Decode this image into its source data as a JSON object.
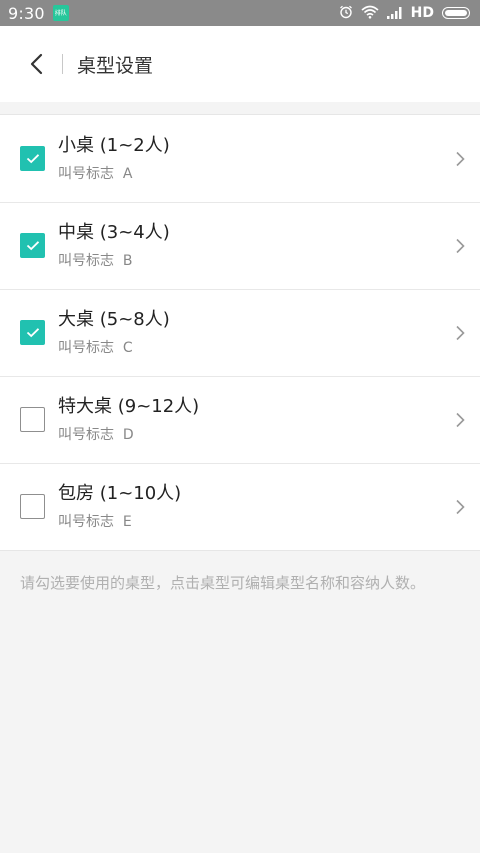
{
  "status_bar": {
    "time": "9:30",
    "network": "HD",
    "notification_app": "排队",
    "icons": [
      "alarm-icon",
      "wifi-icon",
      "signal-icon",
      "battery-icon"
    ]
  },
  "header": {
    "title": "桌型设置",
    "back_icon": "chevron-left-icon"
  },
  "colors": {
    "accent": "#21c1b0",
    "status_bar": "#8a8a8a",
    "background": "#f4f4f4"
  },
  "list": {
    "items": [
      {
        "title": "小桌 (1~2人)",
        "subtitle": "叫号标志  A",
        "checked": true
      },
      {
        "title": "中桌 (3~4人)",
        "subtitle": "叫号标志  B",
        "checked": true
      },
      {
        "title": "大桌 (5~8人)",
        "subtitle": "叫号标志  C",
        "checked": true
      },
      {
        "title": "特大桌 (9~12人)",
        "subtitle": "叫号标志  D",
        "checked": false
      },
      {
        "title": "包房 (1~10人)",
        "subtitle": "叫号标志  E",
        "checked": false
      }
    ]
  },
  "hint": "请勾选要使用的桌型，点击桌型可编辑桌型名称和容纳人数。"
}
